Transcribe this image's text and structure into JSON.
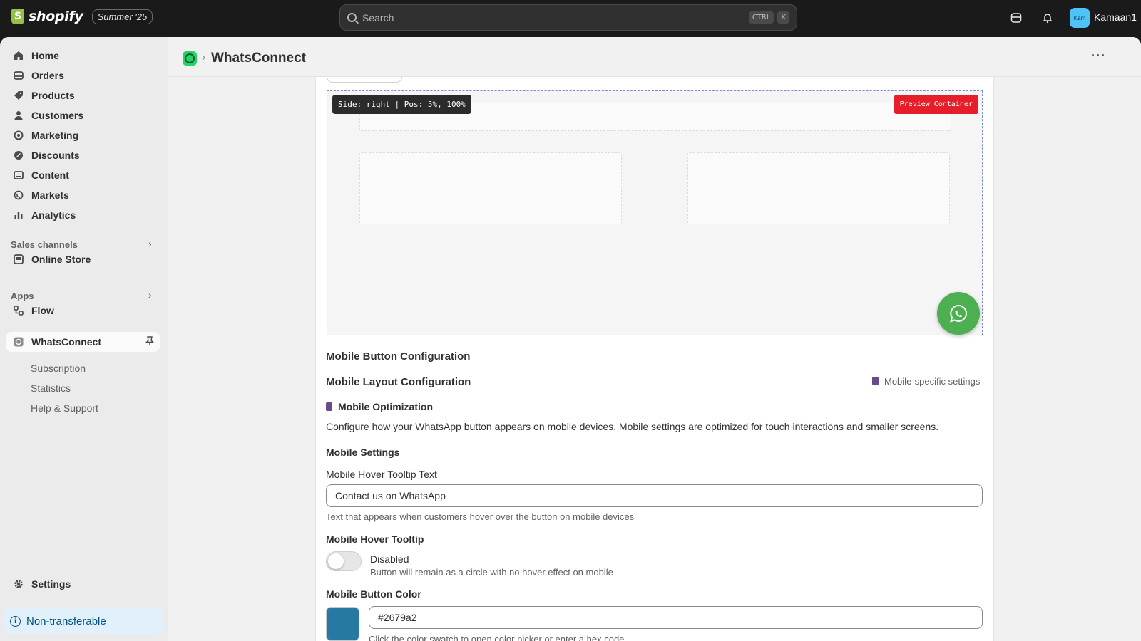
{
  "topbar": {
    "brand": "shopify",
    "edition": "Summer '25",
    "search_placeholder": "Search",
    "shortcut_keys": [
      "CTRL",
      "K"
    ],
    "user_initials": "Kam",
    "user_name": "Kamaan1"
  },
  "sidebar": {
    "nav": [
      {
        "label": "Home",
        "icon": "home-icon"
      },
      {
        "label": "Orders",
        "icon": "orders-icon"
      },
      {
        "label": "Products",
        "icon": "tag-icon"
      },
      {
        "label": "Customers",
        "icon": "person-icon"
      },
      {
        "label": "Marketing",
        "icon": "target-icon"
      },
      {
        "label": "Discounts",
        "icon": "discount-icon"
      },
      {
        "label": "Content",
        "icon": "content-icon"
      },
      {
        "label": "Markets",
        "icon": "globe-icon"
      },
      {
        "label": "Analytics",
        "icon": "bar-chart-icon"
      }
    ],
    "sales_channels_label": "Sales channels",
    "online_store": "Online Store",
    "apps_label": "Apps",
    "flow": "Flow",
    "app_name": "WhatsConnect",
    "app_subitems": [
      "Subscription",
      "Statistics",
      "Help & Support"
    ],
    "settings": "Settings",
    "non_transferable": "Non-transferable"
  },
  "header": {
    "title": "WhatsConnect"
  },
  "preview": {
    "position_badge": "Side: right | Pos: 5%, 100%",
    "label": "Preview Container",
    "button_color": "#4caf50"
  },
  "mobile": {
    "button_config_heading": "Mobile Button Configuration",
    "layout_config_heading": "Mobile Layout Configuration",
    "specific_settings": "Mobile-specific settings",
    "optimization_heading": "Mobile Optimization",
    "optimization_desc": "Configure how your WhatsApp button appears on mobile devices. Mobile settings are optimized for touch interactions and smaller screens.",
    "settings_heading": "Mobile Settings",
    "tooltip_text_label": "Mobile Hover Tooltip Text",
    "tooltip_text_value": "Contact us on WhatsApp",
    "tooltip_text_help": "Text that appears when customers hover over the button on mobile devices",
    "tooltip_toggle_label": "Mobile Hover Tooltip",
    "tooltip_toggle_state": "Disabled",
    "tooltip_toggle_help": "Button will remain as a circle with no hover effect on mobile",
    "color_label": "Mobile Button Color",
    "color_value": "#2679a2",
    "color_help": "Click the color swatch to open color picker or enter a hex code"
  }
}
